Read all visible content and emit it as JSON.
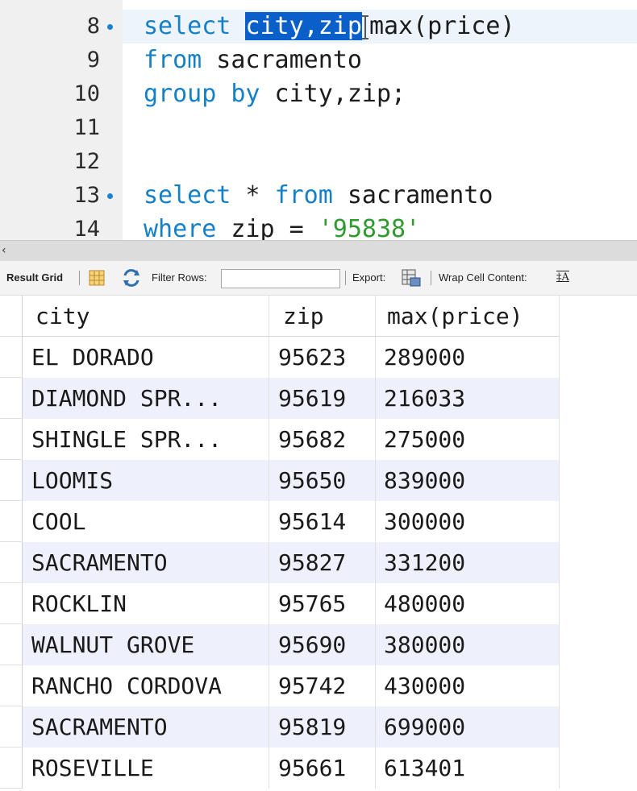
{
  "editor": {
    "lines": [
      {
        "no": "8",
        "has_dot": true
      },
      {
        "no": "9",
        "has_dot": false
      },
      {
        "no": "10",
        "has_dot": false
      },
      {
        "no": "11",
        "has_dot": false
      },
      {
        "no": "12",
        "has_dot": false
      },
      {
        "no": "13",
        "has_dot": true
      },
      {
        "no": "14",
        "has_dot": false
      }
    ],
    "code": {
      "l8_kw_select": "select",
      "l8_selected": "city,zip",
      "l8_rest": "max(price)",
      "l9_kw_from": "from",
      "l9_rest": " sacramento",
      "l10_kw_group": "group by",
      "l10_rest": " city,zip;",
      "l13_kw_select": "select",
      "l13_star": " * ",
      "l13_kw_from": "from",
      "l13_rest": " sacramento",
      "l14_kw_where": "where",
      "l14_mid": " zip = ",
      "l14_str": "'95838'"
    }
  },
  "toolbar": {
    "result_grid_label": "Result Grid",
    "filter_rows_label": "Filter Rows:",
    "filter_rows_value": "",
    "export_label": "Export:",
    "wrap_label": "Wrap Cell Content:"
  },
  "grid": {
    "columns": [
      "city",
      "zip",
      "max(price)"
    ],
    "rows": [
      [
        "EL DORADO",
        "95623",
        "289000"
      ],
      [
        "DIAMOND SPR...",
        "95619",
        "216033"
      ],
      [
        "SHINGLE SPR...",
        "95682",
        "275000"
      ],
      [
        "LOOMIS",
        "95650",
        "839000"
      ],
      [
        "COOL",
        "95614",
        "300000"
      ],
      [
        "SACRAMENTO",
        "95827",
        "331200"
      ],
      [
        "ROCKLIN",
        "95765",
        "480000"
      ],
      [
        "WALNUT GROVE",
        "95690",
        "380000"
      ],
      [
        "RANCHO CORDOVA",
        "95742",
        "430000"
      ],
      [
        "SACRAMENTO",
        "95819",
        "699000"
      ],
      [
        "ROSEVILLE",
        "95661",
        "613401"
      ]
    ]
  },
  "colors": {
    "keyword": "#1480c8",
    "string": "#2e9b2e",
    "selection": "#0a60c8",
    "alt_row": "#eef1fb"
  }
}
